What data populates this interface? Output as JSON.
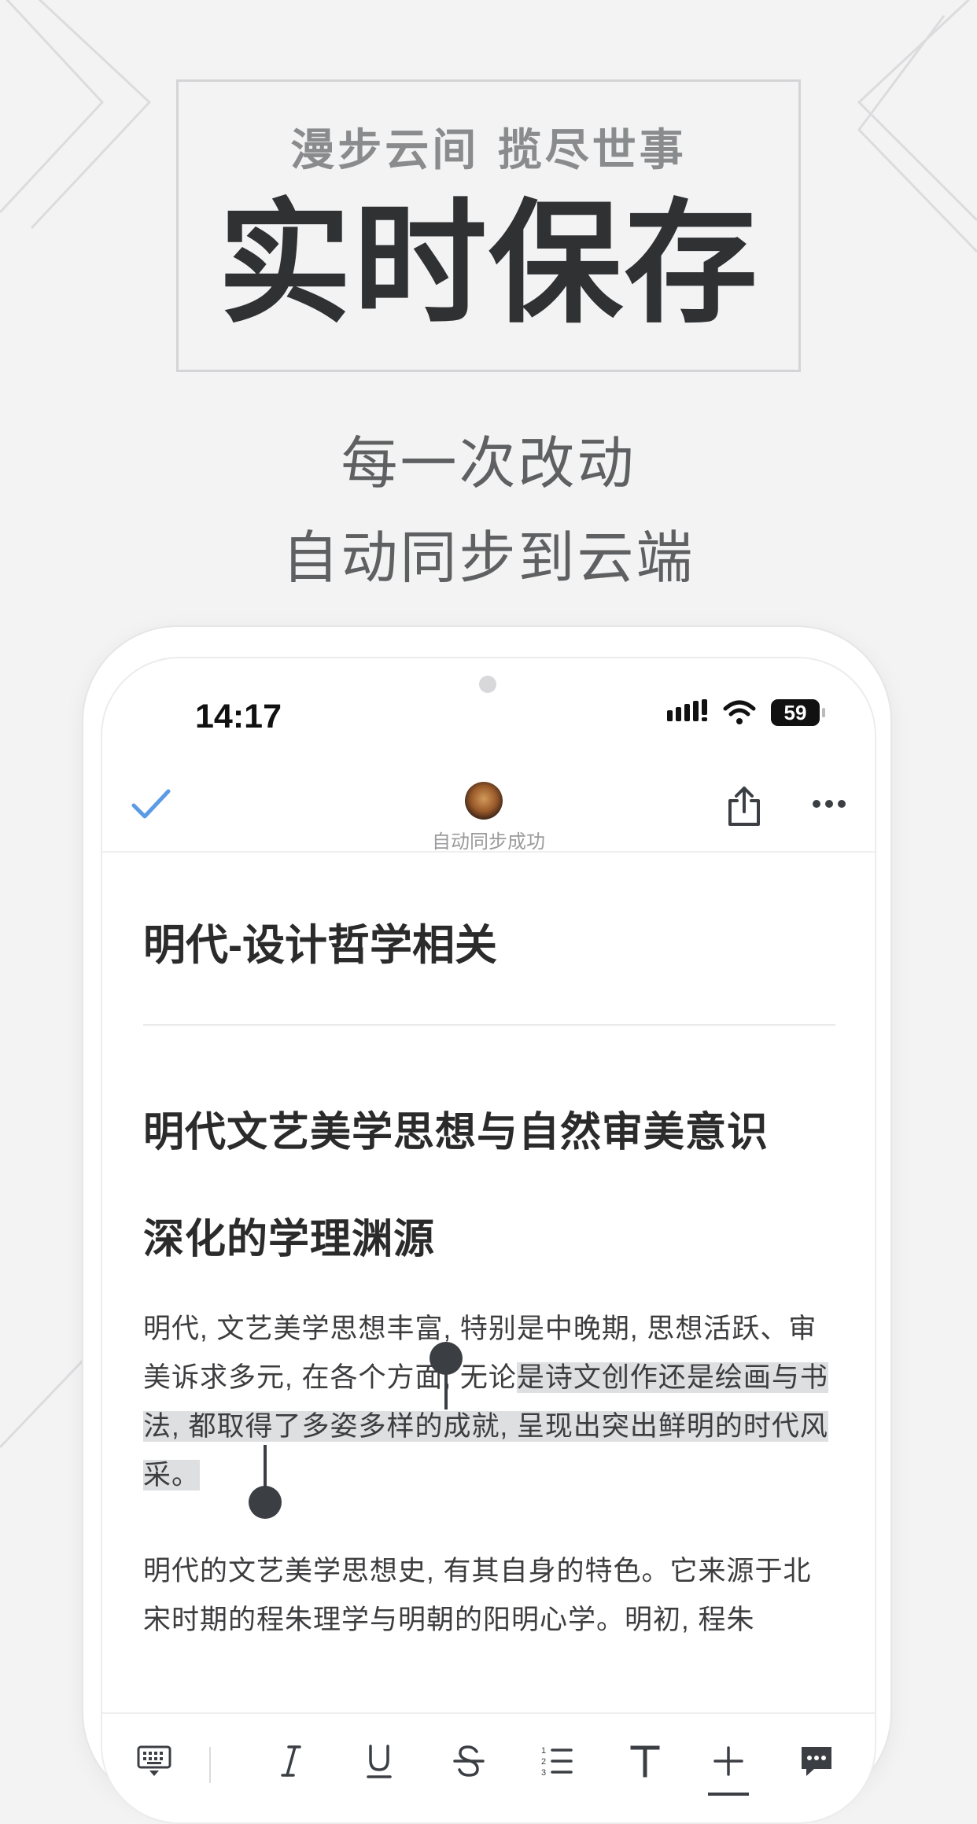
{
  "hero": {
    "tagline": "漫步云间 揽尽世事",
    "title": "实时保存",
    "subtitle_line1": "每一次改动",
    "subtitle_line2": "自动同步到云端"
  },
  "status_bar": {
    "time": "14:17",
    "battery": "59"
  },
  "topbar": {
    "sync_status": "自动同步成功"
  },
  "document": {
    "title": "明代-设计哲学相关",
    "heading_line1": "明代文艺美学思想与自然审美意识",
    "heading_line2": "深化的学理渊源",
    "para1_start": "明代, 文艺美学思想丰富, 特别是中晚期, 思想活跃、审美诉求多元, 在各个方面, 无论",
    "para1_highlight": "是诗文创作还是绘画与书法, 都取得了多姿多样的成就, 呈现出突出鲜明的时代风采。",
    "para2": "明代的文艺美学思想史, 有其自身的特色。它来源于北宋时期的程朱理学与明朝的阳明心学。明初, 程朱"
  },
  "toolbar": {
    "items": [
      "keyboard-icon",
      "italic-icon",
      "underline-icon",
      "strikethrough-icon",
      "numbered-list-icon",
      "text-style-icon",
      "insert-icon",
      "comment-icon"
    ]
  },
  "colors": {
    "background": "#f3f3f4",
    "accent_check": "#5b9be6",
    "text_dark": "#2b2b2b",
    "highlight": "#dedfe1"
  }
}
